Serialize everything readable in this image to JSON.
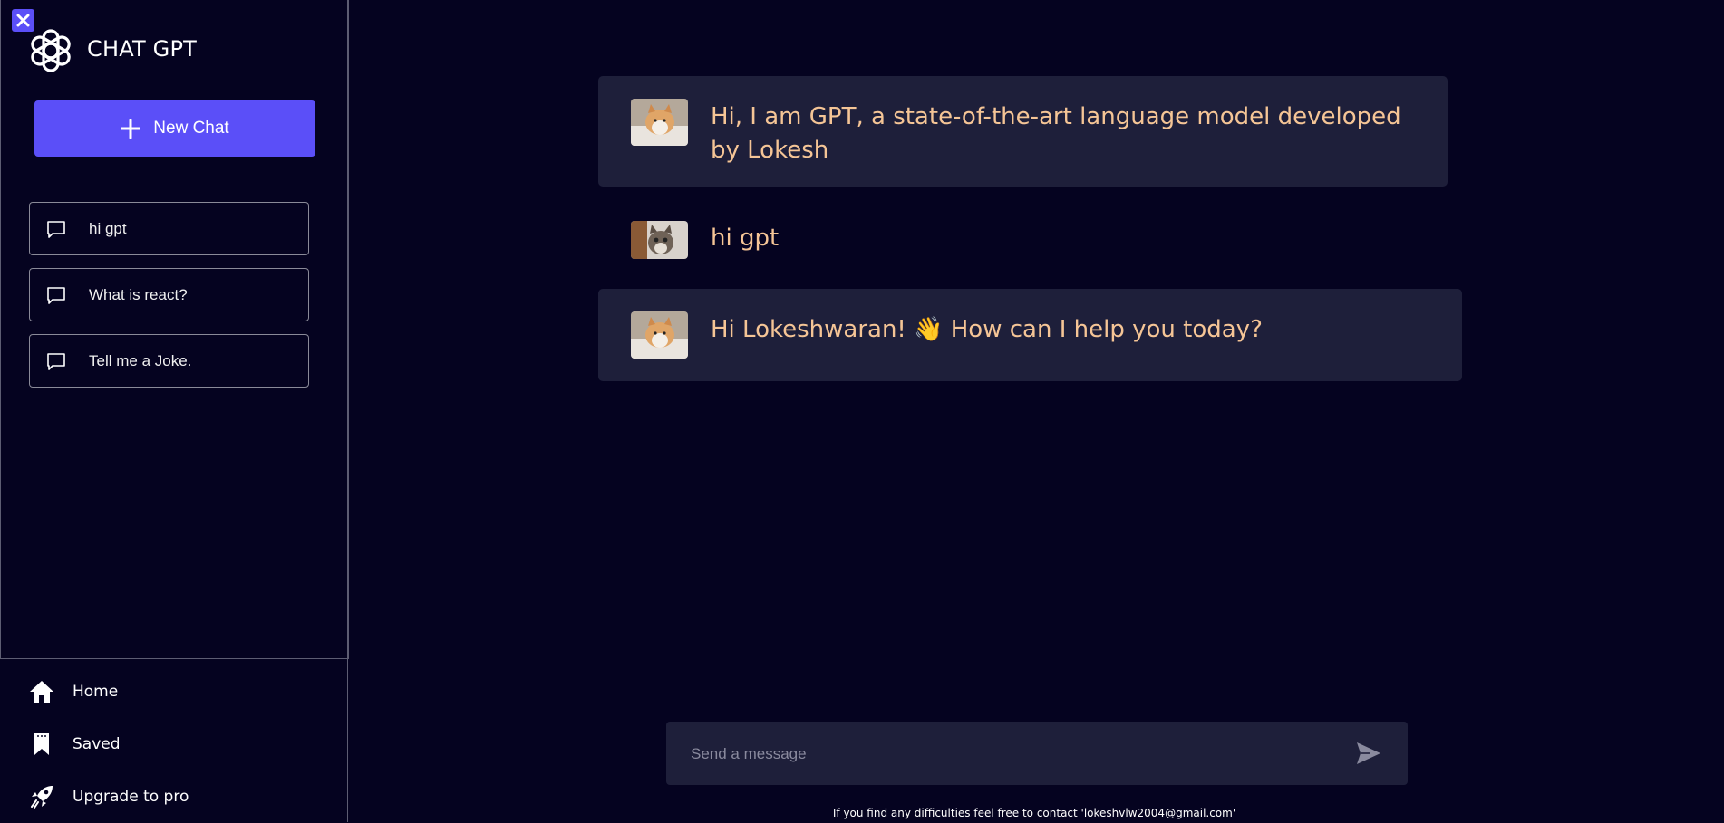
{
  "sidebar": {
    "brand": "CHAT GPT",
    "new_chat_label": "New Chat",
    "history": [
      {
        "label": "hi gpt"
      },
      {
        "label": "What is react?"
      },
      {
        "label": "Tell me a Joke."
      }
    ],
    "nav": [
      {
        "label": "Home",
        "icon": "home-icon"
      },
      {
        "label": "Saved",
        "icon": "bookmark-icon"
      },
      {
        "label": "Upgrade to pro",
        "icon": "rocket-icon"
      }
    ]
  },
  "messages": [
    {
      "role": "bot",
      "text": "Hi, I am GPT, a state-of-the-art language model developed by Lokesh"
    },
    {
      "role": "user",
      "text": "hi gpt"
    },
    {
      "role": "bot",
      "text": "Hi Lokeshwaran! 👋 How can I help you today?"
    }
  ],
  "composer": {
    "placeholder": "Send a message"
  },
  "footer": "If you find any difficulties feel free to contact 'lokeshvlw2004@gmail.com'",
  "colors": {
    "background": "#050320",
    "accent": "#5b4ff8",
    "bubble": "#1e1f3a",
    "message_text": "#f5c596"
  }
}
